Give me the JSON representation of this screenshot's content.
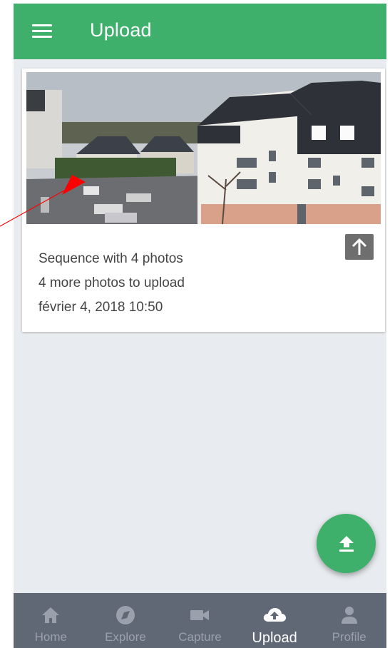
{
  "header": {
    "title": "Upload",
    "menu_icon": "hamburger-menu-icon"
  },
  "card": {
    "sequence_text": "Sequence with 4 photos",
    "remaining_text": "4 more photos to upload",
    "date_text": "février 4, 2018 10:50",
    "upload_icon": "arrow-up-icon"
  },
  "fab": {
    "icon": "upload-icon"
  },
  "nav": {
    "items": [
      {
        "label": "Home",
        "icon": "home-icon"
      },
      {
        "label": "Explore",
        "icon": "compass-icon"
      },
      {
        "label": "Capture",
        "icon": "video-camera-icon"
      },
      {
        "label": "Upload",
        "icon": "cloud-upload-icon",
        "active": true
      },
      {
        "label": "Profile",
        "icon": "person-icon"
      }
    ]
  },
  "colors": {
    "primary": "#3eb06b",
    "navbar": "#606876",
    "background": "#e8ebef",
    "annotation_arrow": "#ff0000"
  }
}
